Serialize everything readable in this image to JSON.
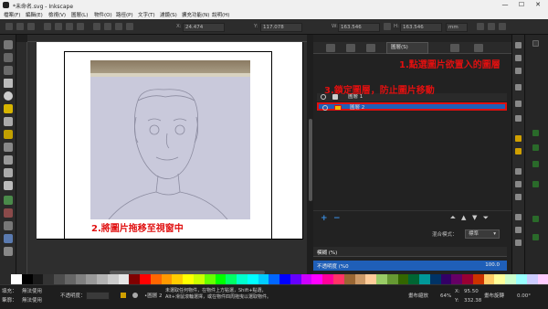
{
  "window": {
    "title": "*未命名.svg - Inkscape",
    "min_label": "—",
    "max_label": "☐",
    "close_label": "✕"
  },
  "menu": [
    "檔案(F)",
    "編輯(E)",
    "檢視(V)",
    "圖層(L)",
    "物件(O)",
    "路徑(P)",
    "文字(T)",
    "濾鏡(S)",
    "擴充功能(N)",
    "說明(H)"
  ],
  "toolbar": {
    "x_label": "X:",
    "x_value": "24.474",
    "y_label": "Y:",
    "y_value": "117.078",
    "w_label": "W:",
    "w_value": "163.546",
    "h_label": "H:",
    "h_value": "163.546",
    "unit": "mm"
  },
  "panel": {
    "layer_tab": "圖層(S)",
    "layers": [
      {
        "name": "圖層 1"
      },
      {
        "name": "圖層 2"
      }
    ],
    "blend_label": "混合模式：",
    "blend_value": "標準",
    "blur_label": "模糊 (%)",
    "blur_value": "",
    "opacity_label": "不透明度 (%0",
    "opacity_value": "100.0"
  },
  "annotations": {
    "step1": "1.點選圖片欲置入的圖層",
    "step2": "2.將圖片拖移至視窗中",
    "step3": "3.鎖定圖層，防止圖片移動"
  },
  "status": {
    "fill_label": "填充：",
    "fill_value": "無法使用",
    "stroke_label": "筆廓：",
    "stroke_value": "無法使用",
    "opacity_label": "不透明度：",
    "layer_label": "•圖層 2",
    "message": "未選取任何物件，在物件上方點選，Shift+點選，Alt+滑鼠滾輪選擇，或在物件四周拖曳以選取物件。",
    "x_label": "X:",
    "x_value": "95.50",
    "y_label": "Y:",
    "y_value": "332.38",
    "zoom_label": "畫布縮放",
    "zoom_value": "64%",
    "rotate_label": "畫布旋轉",
    "rotate_value": "0.00°"
  },
  "palette_colors": [
    "#ffffff",
    "#000000",
    "#1a1a1a",
    "#333333",
    "#4d4d4d",
    "#666666",
    "#808080",
    "#999999",
    "#b3b3b3",
    "#cccccc",
    "#e6e6e6",
    "#800000",
    "#ff0000",
    "#ff6600",
    "#ff9900",
    "#ffcc00",
    "#ffff00",
    "#ccff00",
    "#66ff00",
    "#00ff00",
    "#00ff66",
    "#00ffcc",
    "#00ffff",
    "#00ccff",
    "#0066ff",
    "#0000ff",
    "#6600ff",
    "#cc00ff",
    "#ff00ff",
    "#ff0099",
    "#ff3366",
    "#996633",
    "#cc9966",
    "#ffcc99",
    "#99cc66",
    "#669933",
    "#336600",
    "#006633",
    "#009999",
    "#003366",
    "#330066",
    "#660066",
    "#990033",
    "#cc3300",
    "#ffcc66",
    "#ffff99",
    "#ccffcc",
    "#99ffff",
    "#ccccff",
    "#ffccff"
  ],
  "colors": {
    "accent_blue": "#1f5fb8",
    "annotation_red": "#e01010"
  }
}
